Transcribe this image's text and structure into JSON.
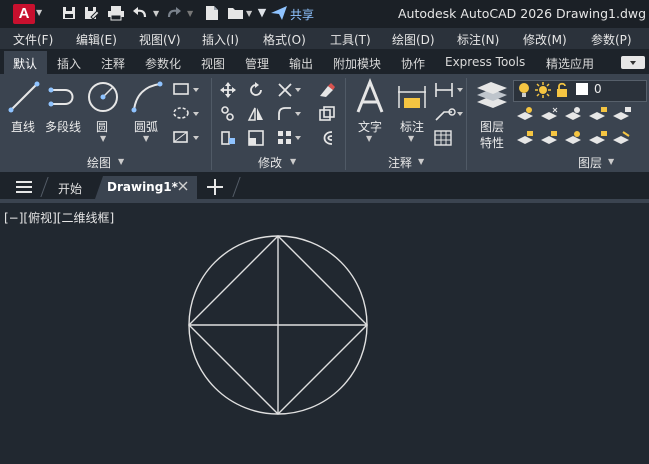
{
  "titlebar": {
    "app_logo": "A",
    "share": "共享",
    "title": "Autodesk AutoCAD 2026    Drawing1.dwg",
    "icons": [
      "save-icon",
      "save-as-icon",
      "print-icon",
      "undo-icon",
      "redo-icon",
      "new-icon",
      "open-icon",
      "customize-icon",
      "share-icon"
    ]
  },
  "menus": [
    "文件(F)",
    "编辑(E)",
    "视图(V)",
    "插入(I)",
    "格式(O)",
    "工具(T)",
    "绘图(D)",
    "标注(N)",
    "修改(M)",
    "参数(P)"
  ],
  "ribbon_tabs": [
    "默认",
    "插入",
    "注释",
    "参数化",
    "视图",
    "管理",
    "输出",
    "附加模块",
    "协作",
    "Express Tools",
    "精选应用"
  ],
  "ribbon": {
    "draw": {
      "panel": "绘图",
      "line": "直线",
      "polyline": "多段线",
      "circle": "圆",
      "arc": "圆弧"
    },
    "modify": {
      "panel": "修改"
    },
    "annotation": {
      "panel": "注释",
      "text": "文字",
      "dimension": "标注"
    },
    "layers": {
      "panel": "图层",
      "properties_1": "图层",
      "properties_2": "特性",
      "current_layer": "0"
    }
  },
  "doc_tabs": {
    "start": "开始",
    "active": "Drawing1*"
  },
  "viewport_label": "[−][俯视][二维线框]",
  "colors": {
    "accent": "#c8102e",
    "canvas": "#212830",
    "ribbon": "#3b4450",
    "lightbulb": "#f5c542"
  }
}
